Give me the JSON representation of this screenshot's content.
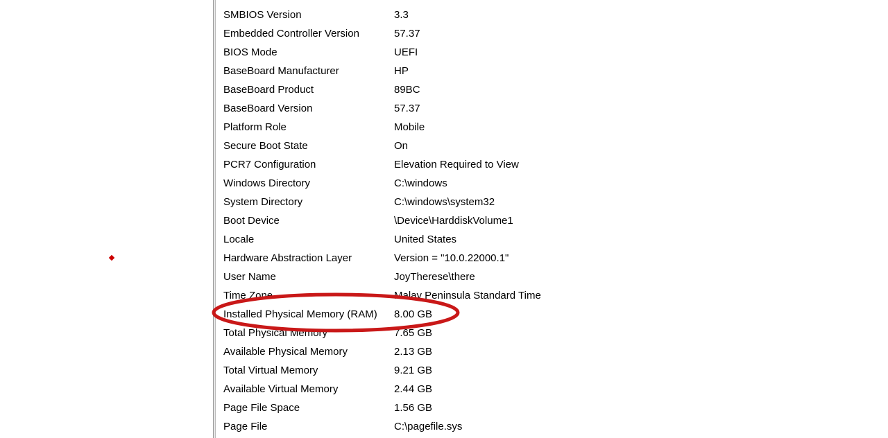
{
  "system_info": {
    "rows": [
      {
        "label": "SMBIOS Version",
        "value": "3.3"
      },
      {
        "label": "Embedded Controller Version",
        "value": "57.37"
      },
      {
        "label": "BIOS Mode",
        "value": "UEFI"
      },
      {
        "label": "BaseBoard Manufacturer",
        "value": "HP"
      },
      {
        "label": "BaseBoard Product",
        "value": "89BC"
      },
      {
        "label": "BaseBoard Version",
        "value": "57.37"
      },
      {
        "label": "Platform Role",
        "value": "Mobile"
      },
      {
        "label": "Secure Boot State",
        "value": "On"
      },
      {
        "label": "PCR7 Configuration",
        "value": "Elevation Required to View"
      },
      {
        "label": "Windows Directory",
        "value": "C:\\windows"
      },
      {
        "label": "System Directory",
        "value": "C:\\windows\\system32"
      },
      {
        "label": "Boot Device",
        "value": "\\Device\\HarddiskVolume1"
      },
      {
        "label": "Locale",
        "value": "United States"
      },
      {
        "label": "Hardware Abstraction Layer",
        "value": "Version = \"10.0.22000.1\""
      },
      {
        "label": "User Name",
        "value": "JoyTherese\\there"
      },
      {
        "label": "Time Zone",
        "value": "Malay Peninsula Standard Time"
      },
      {
        "label": "Installed Physical Memory (RAM)",
        "value": "8.00 GB"
      },
      {
        "label": "Total Physical Memory",
        "value": "7.65 GB"
      },
      {
        "label": "Available Physical Memory",
        "value": "2.13 GB"
      },
      {
        "label": "Total Virtual Memory",
        "value": "9.21 GB"
      },
      {
        "label": "Available Virtual Memory",
        "value": "2.44 GB"
      },
      {
        "label": "Page File Space",
        "value": "1.56 GB"
      },
      {
        "label": "Page File",
        "value": "C:\\pagefile.sys"
      }
    ]
  }
}
